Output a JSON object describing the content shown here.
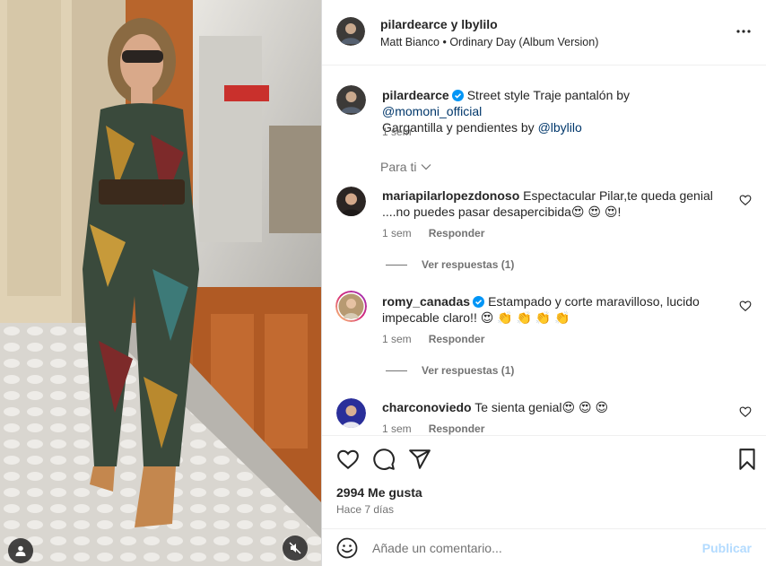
{
  "header": {
    "title": "pilardearce y lbylilo",
    "audio": "Matt Bianco • Ordinary Day (Album Version)",
    "more_icon": "more-horizontal-icon"
  },
  "caption": {
    "username": "pilardearce",
    "verified": true,
    "text_1": "Street style Traje pantalón by ",
    "mention_1": "@momoni_official",
    "text_2": "Gargantilla y pendientes by ",
    "mention_2": "@lbylilo",
    "time": "1 sem"
  },
  "filter": {
    "label": "Para ti"
  },
  "comments": [
    {
      "username": "mariapilarlopezdonoso",
      "verified": false,
      "text": "Espectacular Pilar,te queda genial ....no puedes pasar desapercibida😍 😍 😍!",
      "time": "1 sem",
      "reply": "Responder",
      "view_replies": "Ver respuestas (1)"
    },
    {
      "username": "romy_canadas",
      "verified": true,
      "text": "Estampado y corte maravilloso, lucido impecable claro!! 😍 👏 👏 👏 👏",
      "time": "1 sem",
      "reply": "Responder",
      "view_replies": "Ver respuestas (1)"
    },
    {
      "username": "charconoviedo",
      "verified": false,
      "text": "Te sienta genial😍 😍 😍",
      "time": "1 sem",
      "reply": "Responder"
    }
  ],
  "actions": {
    "likes": "2994 Me gusta",
    "time_ago": "Hace 7 días"
  },
  "comment_box": {
    "placeholder": "Añade un comentario...",
    "post_label": "Publicar"
  },
  "colors": {
    "link": "#00376b",
    "secondary_text": "#737373",
    "post_disabled": "#b3dbff",
    "verified_blue": "#0095f6"
  }
}
